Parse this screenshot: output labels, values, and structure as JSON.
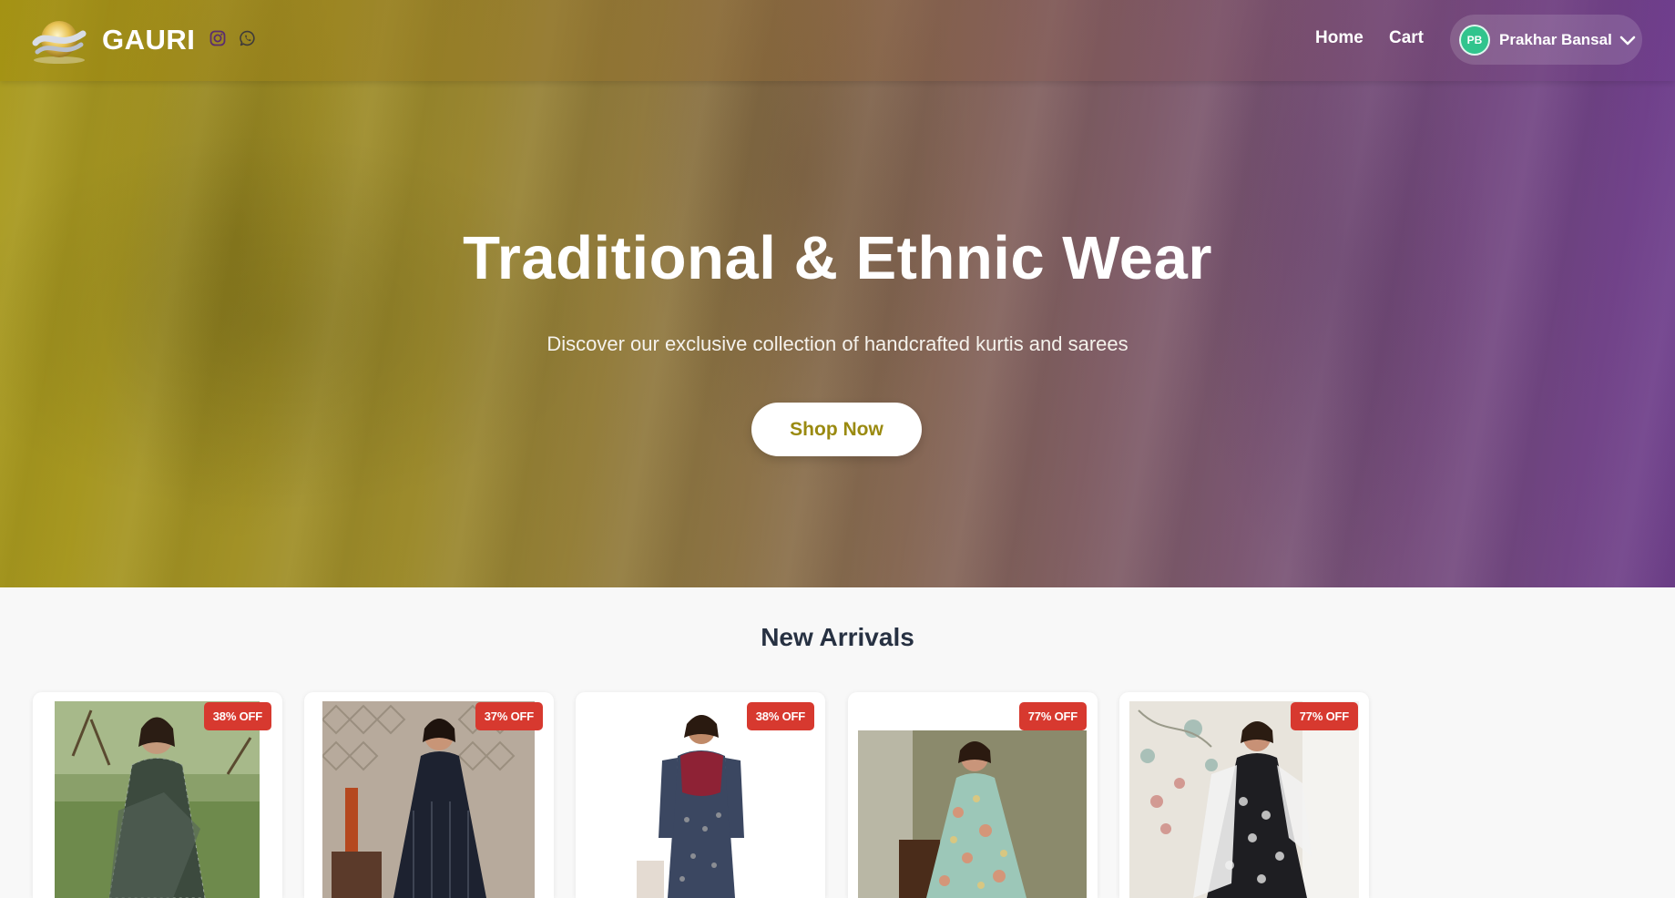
{
  "brand": {
    "name": "GAURI",
    "logo_icon": "gauri-logo",
    "social": [
      {
        "name": "instagram-icon"
      },
      {
        "name": "whatsapp-icon"
      }
    ]
  },
  "nav": {
    "home": "Home",
    "cart": "Cart",
    "user": {
      "initials": "PB",
      "name": "Prakhar Bansal",
      "avatar_color": "#31c48d"
    }
  },
  "hero": {
    "title": "Traditional & Ethnic Wear",
    "subtitle": "Discover our exclusive collection of handcrafted kurtis and sarees",
    "cta": "Shop Now",
    "gradient_start": "#a99a1e",
    "gradient_end": "#6f3f8c"
  },
  "new_arrivals": {
    "title": "New Arrivals",
    "products": [
      {
        "discount": "38% OFF"
      },
      {
        "discount": "37% OFF"
      },
      {
        "discount": "38% OFF"
      },
      {
        "discount": "77% OFF"
      },
      {
        "discount": "77% OFF"
      }
    ],
    "badge_color": "#d7392f"
  }
}
